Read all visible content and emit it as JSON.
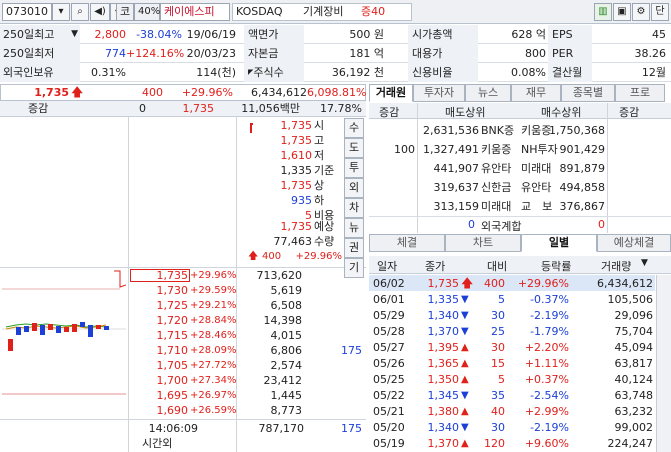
{
  "toolbar": {
    "code": "073010",
    "market_toggle": "코",
    "pct": "40%",
    "name": "케이에스피",
    "market": "KOSDAQ",
    "sector": "기계장비",
    "margin": "증40",
    "tail_label": "단"
  },
  "info": {
    "row1": {
      "l1": "250일최고",
      "v1": "2,800",
      "p1": "-38.04%",
      "d1": "19/06/19",
      "l2": "액면가",
      "v2": "500 원",
      "l3": "시가총액",
      "v3": "628 억",
      "l4": "EPS",
      "v4": "45"
    },
    "row2": {
      "l1": "250일최저",
      "v1": "774",
      "p1": "+124.16%",
      "d1": "20/03/23",
      "l2": "자본금",
      "v2": "181 억",
      "l3": "대용가",
      "v3": "800",
      "l4": "PER",
      "v4": "38.26"
    },
    "row3": {
      "l1": "외국인보유",
      "v1": "0.31%",
      "q1": "114(천)",
      "l2": "주식수",
      "v2": "36,192 천",
      "l3": "신용비율",
      "v3": "0.08%",
      "l4": "결산월",
      "v4": "12월"
    }
  },
  "quote": {
    "price": "1,735",
    "change": "400",
    "rate": "+29.96%",
    "volume": "6,434,612",
    "vol_ratio": "6,098.81%",
    "hdr_label": "증감",
    "hdr_zero": "0",
    "hdr_price": "1,735",
    "hdr_amount": "11,056백만",
    "hdr_pct": "17.78%"
  },
  "summary": [
    {
      "v": "1,735",
      "k": "시"
    },
    {
      "v": "1,735",
      "k": "고"
    },
    {
      "v": "1,610",
      "k": "저"
    },
    {
      "v": "1,335",
      "k": "기준"
    },
    {
      "v": "1,735",
      "k": "상"
    },
    {
      "v": "935",
      "k": "하"
    },
    {
      "v": "5",
      "k": "비용"
    }
  ],
  "expected": {
    "price": "1,735",
    "price_label": "예상",
    "qty": "77,463",
    "qty_label": "수량",
    "chg": "400",
    "rate": "+29.96%"
  },
  "side_tabs": [
    "수",
    "도",
    "투",
    "외",
    "차",
    "뉴",
    "권",
    "기"
  ],
  "bids": [
    {
      "p": "1,735",
      "r": "+29.96%",
      "q": "713,620",
      "x": ""
    },
    {
      "p": "1,730",
      "r": "+29.59%",
      "q": "5,619",
      "x": ""
    },
    {
      "p": "1,725",
      "r": "+29.21%",
      "q": "6,508",
      "x": ""
    },
    {
      "p": "1,720",
      "r": "+28.84%",
      "q": "14,398",
      "x": ""
    },
    {
      "p": "1,715",
      "r": "+28.46%",
      "q": "4,015",
      "x": ""
    },
    {
      "p": "1,710",
      "r": "+28.09%",
      "q": "6,806",
      "x": "175"
    },
    {
      "p": "1,705",
      "r": "+27.72%",
      "q": "2,574",
      "x": ""
    },
    {
      "p": "1,700",
      "r": "+27.34%",
      "q": "23,412",
      "x": ""
    },
    {
      "p": "1,695",
      "r": "+26.97%",
      "q": "1,445",
      "x": ""
    },
    {
      "p": "1,690",
      "r": "+26.59%",
      "q": "8,773",
      "x": ""
    }
  ],
  "footer": {
    "time": "14:06:09",
    "after": "시간외",
    "total": "787,170",
    "right": "175"
  },
  "top_tabs": [
    "거래원",
    "투자자",
    "뉴스",
    "재무",
    "종목별",
    "프로"
  ],
  "broker": {
    "h_change": "증감",
    "h_sell": "매도상위",
    "h_buy": "매수상위",
    "h_change2": "증감",
    "rows": [
      {
        "c": "",
        "sq": "2,631,536",
        "sn": "BNK증",
        "bn": "키움증",
        "bq": "1,750,368"
      },
      {
        "c": "100",
        "sq": "1,327,491",
        "sn": "키움증",
        "bn": "NH투자",
        "bq": "901,429"
      },
      {
        "c": "",
        "sq": "441,907",
        "sn": "유안타",
        "bn": "미래대",
        "bq": "891,879"
      },
      {
        "c": "",
        "sq": "319,637",
        "sn": "신한금",
        "bn": "유안타",
        "bq": "494,858"
      },
      {
        "c": "",
        "sq": "313,159",
        "sn": "미래대",
        "bn": "교　보",
        "bq": "376,867"
      }
    ],
    "foreign_sell": "0",
    "foreign_label": "외국계합",
    "foreign_buy": "0"
  },
  "bottom_tabs": [
    "체결",
    "차트",
    "일별",
    "예상체결"
  ],
  "daily": {
    "headers": [
      "일자",
      "종가",
      "대비",
      "등락률",
      "거래량"
    ],
    "rows": [
      {
        "d": "06/02",
        "c": "1,735",
        "dir": "up",
        "ch": "400",
        "r": "+29.96%",
        "v": "6,434,612"
      },
      {
        "d": "06/01",
        "c": "1,335",
        "dir": "down",
        "ch": "5",
        "r": "-0.37%",
        "v": "105,506"
      },
      {
        "d": "05/29",
        "c": "1,340",
        "dir": "down",
        "ch": "30",
        "r": "-2.19%",
        "v": "29,096"
      },
      {
        "d": "05/28",
        "c": "1,370",
        "dir": "down",
        "ch": "25",
        "r": "-1.79%",
        "v": "75,704"
      },
      {
        "d": "05/27",
        "c": "1,395",
        "dir": "up",
        "ch": "30",
        "r": "+2.20%",
        "v": "45,094"
      },
      {
        "d": "05/26",
        "c": "1,365",
        "dir": "up",
        "ch": "15",
        "r": "+1.11%",
        "v": "63,817"
      },
      {
        "d": "05/25",
        "c": "1,350",
        "dir": "up",
        "ch": "5",
        "r": "+0.37%",
        "v": "40,124"
      },
      {
        "d": "05/22",
        "c": "1,345",
        "dir": "down",
        "ch": "35",
        "r": "-2.54%",
        "v": "63,748"
      },
      {
        "d": "05/21",
        "c": "1,380",
        "dir": "up",
        "ch": "40",
        "r": "+2.99%",
        "v": "63,232"
      },
      {
        "d": "05/20",
        "c": "1,340",
        "dir": "down",
        "ch": "30",
        "r": "-2.19%",
        "v": "99,002"
      },
      {
        "d": "05/19",
        "c": "1,370",
        "dir": "up",
        "ch": "120",
        "r": "+9.60%",
        "v": "224,247"
      }
    ]
  },
  "colors": {
    "up": "#e0201b",
    "down": "#1c3fd6",
    "header": "#eef1f6",
    "highlight": "#dbe6f7"
  }
}
